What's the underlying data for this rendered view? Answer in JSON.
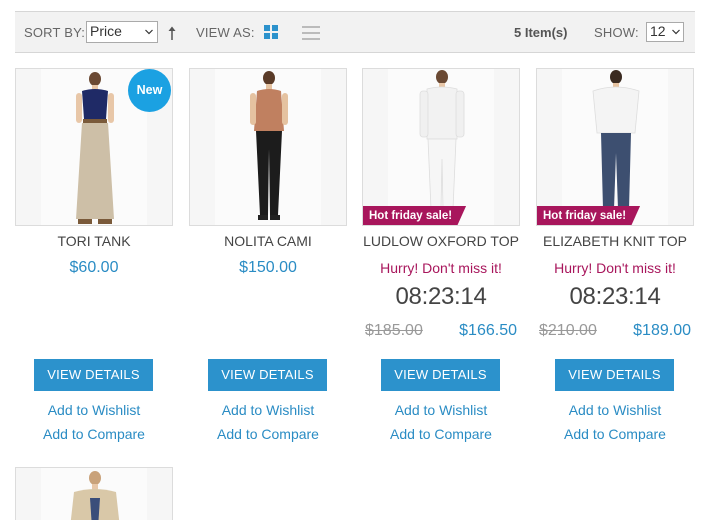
{
  "toolbar": {
    "sort_label": "SORT BY:",
    "sort_value": "Price",
    "view_label": "VIEW AS:",
    "items_count": "5 Item(s)",
    "show_label": "SHOW:",
    "show_value": "12"
  },
  "products": [
    {
      "name": "TORI TANK",
      "price": "$60.00",
      "badge": "New",
      "button": "VIEW DETAILS",
      "wishlist": "Add to Wishlist",
      "compare": "Add to Compare"
    },
    {
      "name": "NOLITA CAMI",
      "price": "$150.00",
      "button": "VIEW DETAILS",
      "wishlist": "Add to Wishlist",
      "compare": "Add to Compare"
    },
    {
      "name": "LUDLOW OXFORD TOP",
      "ribbon": "Hot friday sale!",
      "hurry": "Hurry! Don't miss it!",
      "timer": "08:23:14",
      "old_price": "$185.00",
      "price": "$166.50",
      "button": "VIEW DETAILS",
      "wishlist": "Add to Wishlist",
      "compare": "Add to Compare"
    },
    {
      "name": "ELIZABETH KNIT TOP",
      "ribbon": "Hot friday sale!",
      "hurry": "Hurry! Don't miss it!",
      "timer": "08:23:14",
      "old_price": "$210.00",
      "price": "$189.00",
      "button": "VIEW DETAILS",
      "wishlist": "Add to Wishlist",
      "compare": "Add to Compare"
    }
  ],
  "colors": {
    "accent": "#2c92cc",
    "sale": "#a8165c",
    "badge": "#1ba1e2"
  },
  "icons": [
    "chevron-down-icon",
    "sort-ascending-icon",
    "grid-view-icon",
    "list-view-icon"
  ]
}
